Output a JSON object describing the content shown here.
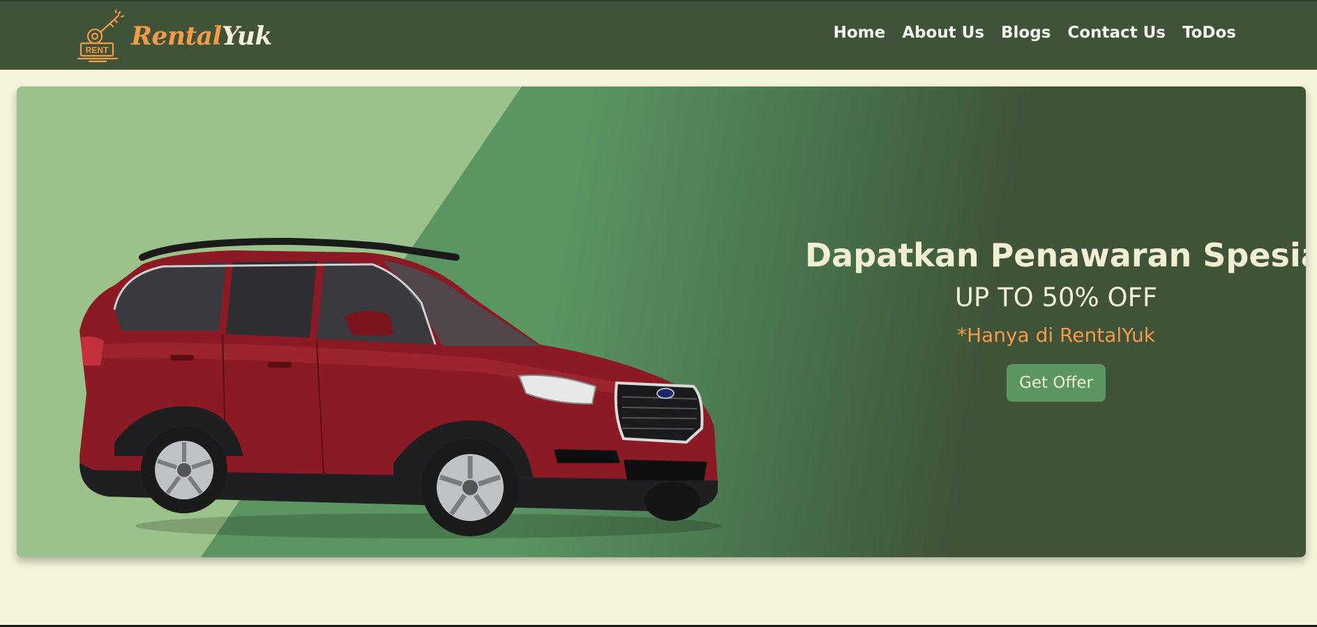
{
  "brand": {
    "name_part1": "Rental",
    "name_part2": "Yuk",
    "logo_badge": "RENT",
    "logo_icon": "key-icon"
  },
  "nav": {
    "items": [
      {
        "label": "Home"
      },
      {
        "label": "About Us"
      },
      {
        "label": "Blogs"
      },
      {
        "label": "Contact Us"
      },
      {
        "label": "ToDos"
      }
    ]
  },
  "hero": {
    "title": "Dapatkan Penawaran Spesial",
    "subtitle": "UP TO 50% OFF",
    "note": "*Hanya di RentalYuk",
    "cta_label": "Get Offer",
    "image": "red-suv-car"
  },
  "colors": {
    "navbar": "#3f5339",
    "page_bg": "#f5f5dc",
    "accent_orange": "#f59a45",
    "light_green": "#9bc28a",
    "mid_green": "#5a9562",
    "dark_green": "#3f5339",
    "car_red": "#8b1a24"
  }
}
